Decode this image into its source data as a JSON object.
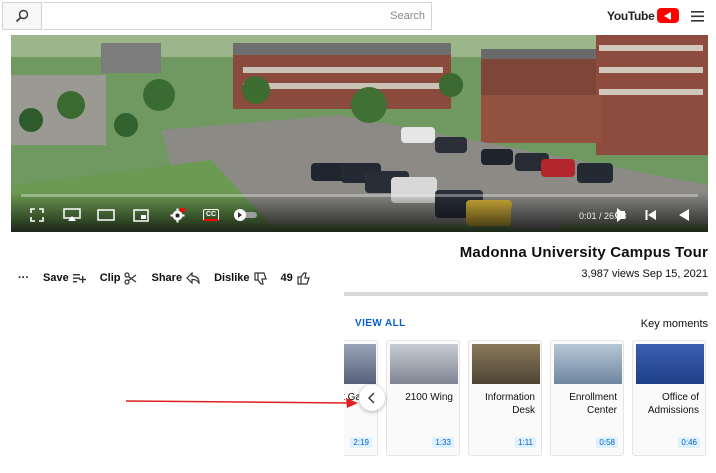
{
  "header": {
    "search_placeholder": "Search",
    "logo_text": "YouTube",
    "icons": {
      "search": "search-icon",
      "menu": "hamburger-menu-icon",
      "logo": "youtube-play-icon"
    },
    "brand_color": "#ff0000"
  },
  "player": {
    "time": "0:01 / 26:03",
    "progress": 0.001,
    "icons": [
      "play-icon",
      "next-icon",
      "volume-icon",
      "autoplay-toggle",
      "cc-icon",
      "settings-icon",
      "miniplayer-icon",
      "theater-icon",
      "cast-icon",
      "fullscreen-icon"
    ],
    "cc_label": "CC"
  },
  "video": {
    "title": "Madonna University Campus Tour",
    "meta": "3,987 views  Sep 15, 2021"
  },
  "actions": {
    "like_count": "49",
    "dislike_label": "Dislike",
    "share_label": "Share",
    "clip_label": "Clip",
    "save_label": "Save",
    "more_label": "···"
  },
  "key_moments": {
    "title": "Key moments",
    "view_all": "VIEW ALL",
    "items": [
      {
        "label": "Office of Admissions",
        "time": "0:46"
      },
      {
        "label": "Enrollment Center",
        "time": "0:58"
      },
      {
        "label": "Information Desk",
        "time": "1:11"
      },
      {
        "label": "2100 Wing",
        "time": "1:33"
      },
      {
        "label": "Exhibit Galle",
        "time": "2:19"
      }
    ]
  }
}
